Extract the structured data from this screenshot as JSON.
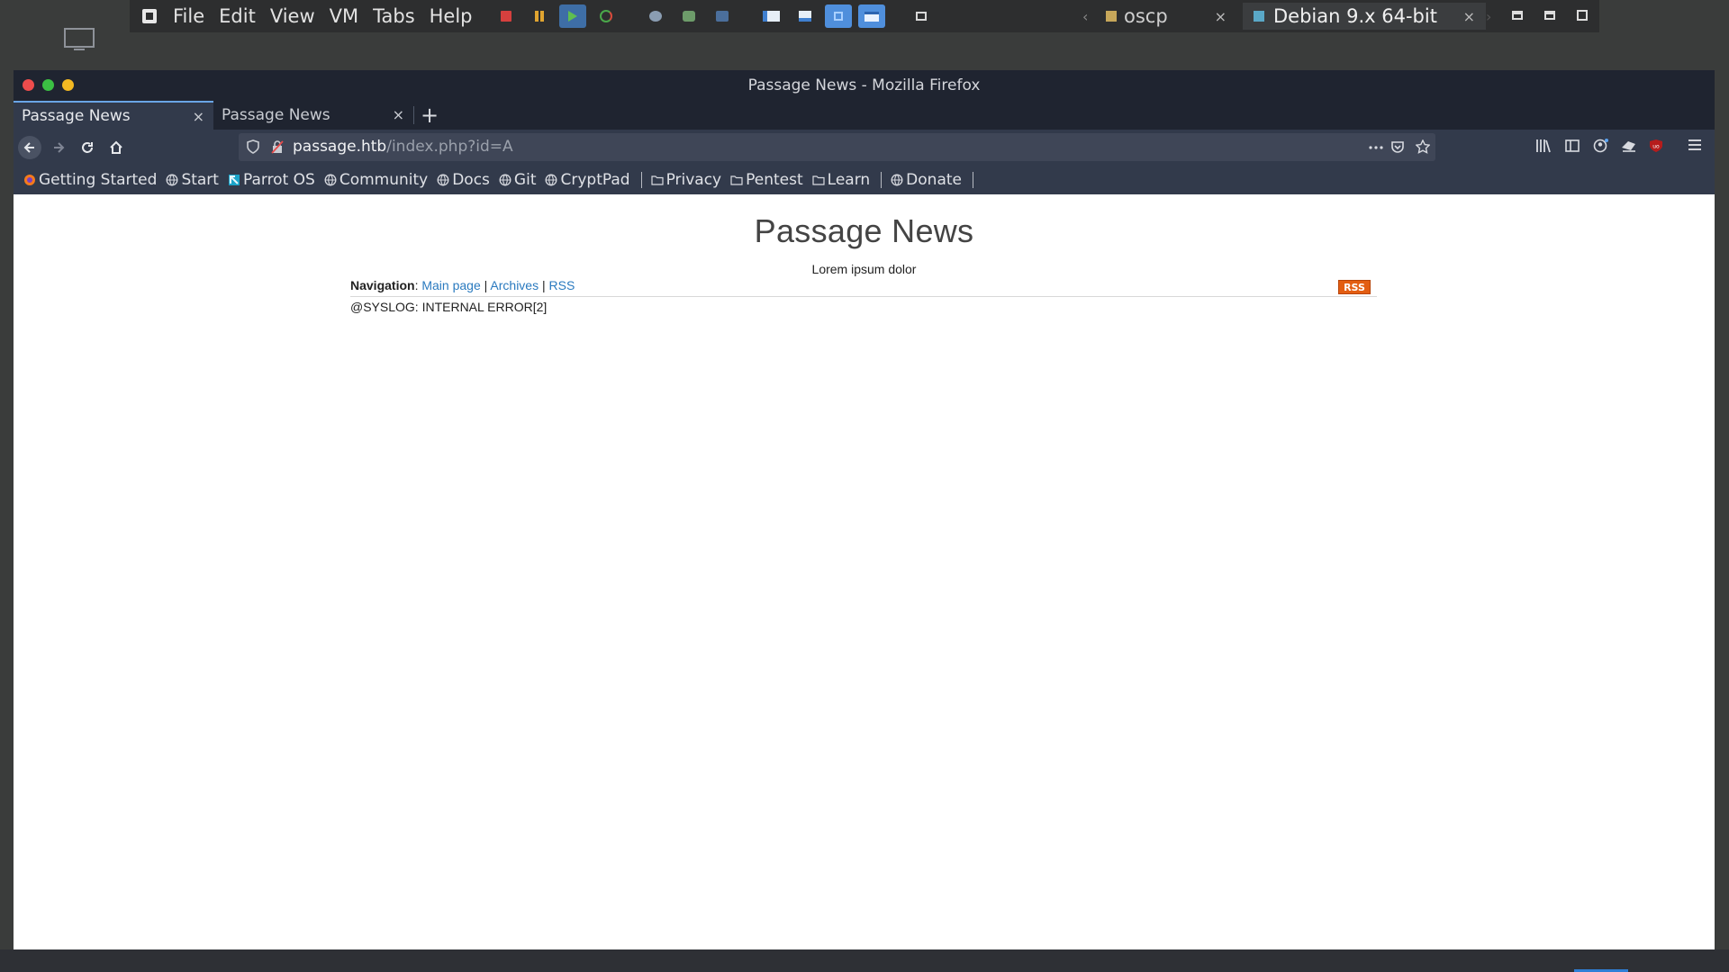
{
  "vm": {
    "menu": [
      "File",
      "Edit",
      "View",
      "VM",
      "Tabs",
      "Help"
    ],
    "tabs": [
      {
        "label": "oscp",
        "close": "×"
      },
      {
        "label": "Debian 9.x 64-bit",
        "close": "×"
      }
    ]
  },
  "firefox": {
    "window_title": "Passage News - Mozilla Firefox",
    "tabs": [
      {
        "label": "Passage News",
        "close": "×"
      },
      {
        "label": "Passage News",
        "close": "×"
      }
    ],
    "new_tab": "+",
    "url": {
      "host": "passage.htb",
      "path": "/index.php?id=A"
    },
    "bookmarks": [
      {
        "label": "Getting Started",
        "icon": "firefox-icon"
      },
      {
        "label": "Start",
        "icon": "globe-icon"
      },
      {
        "label": "Parrot OS",
        "icon": "parrot-icon"
      },
      {
        "label": "Community",
        "icon": "globe-icon"
      },
      {
        "label": "Docs",
        "icon": "globe-icon"
      },
      {
        "label": "Git",
        "icon": "globe-icon"
      },
      {
        "label": "CryptPad",
        "icon": "globe-icon"
      },
      {
        "label": "Privacy",
        "icon": "folder-icon"
      },
      {
        "label": "Pentest",
        "icon": "folder-icon"
      },
      {
        "label": "Learn",
        "icon": "folder-icon"
      },
      {
        "label": "Donate",
        "icon": "globe-icon"
      }
    ]
  },
  "page": {
    "title": "Passage News",
    "subtitle": "Lorem ipsum dolor",
    "nav_label": "Navigation",
    "nav_links": [
      "Main page",
      "Archives",
      "RSS"
    ],
    "rss_badge": "RSS",
    "message": "@SYSLOG: INTERNAL ERROR[2]"
  },
  "colors": {
    "accent": "#6aa5e6",
    "link": "#2a7abf",
    "rss": "#e35d11"
  }
}
